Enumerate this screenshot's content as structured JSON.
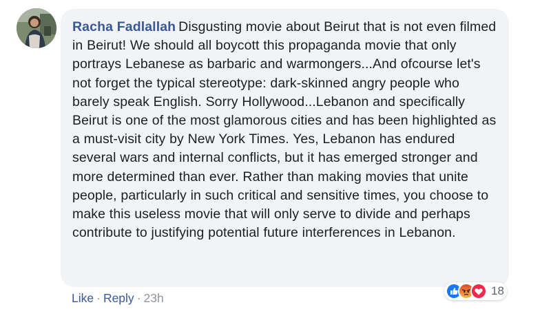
{
  "comment": {
    "author": "Racha Fadlallah",
    "text": "Disgusting movie about Beirut that is not even filmed in Beirut! We should all boycott this propaganda movie that only portrays Lebanese as barbaric and warmongers...And ofcourse let's not forget the typical stereotype: dark-skinned angry people who barely speak English. Sorry Hollywood...Lebanon and specifically Beirut is one of the most glamorous cities and has been highlighted as a must-visit city by New York Times. Yes, Lebanon has endured several wars and internal conflicts, but it has emerged stronger and more determined than ever. Rather than making movies that unite people, particularly in such critical and sensitive times, you choose to make this useless movie that will only serve to divide and perhaps contribute to justifying potential future interferences in Lebanon.",
    "actions": {
      "like_label": "Like",
      "reply_label": "Reply",
      "separator": "·",
      "time": "23h"
    },
    "reactions": {
      "icons": [
        "like-icon",
        "angry-icon",
        "love-icon"
      ],
      "count": "18"
    }
  },
  "colors": {
    "author_link": "#385898",
    "bubble_bg": "#f2f3f5",
    "meta_text": "#90949c",
    "like_blue": "#1877f2",
    "angry_orange": "#f0892f",
    "love_red": "#f0284a"
  }
}
